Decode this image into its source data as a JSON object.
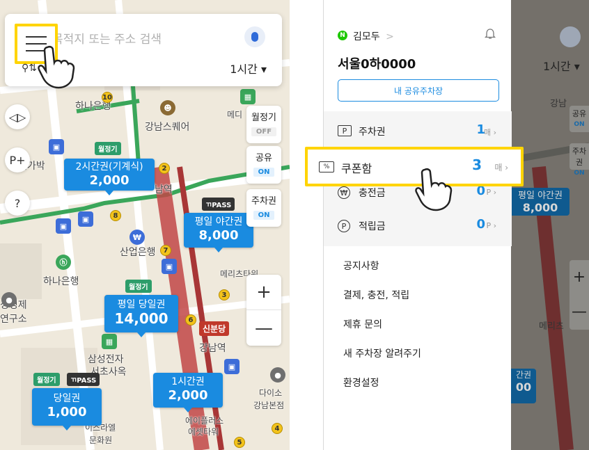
{
  "left": {
    "search": {
      "placeholder": "목적지 또는 주소 검색",
      "time": "1시간 ▾",
      "filter": "⚲⇅"
    },
    "map_labels": [
      {
        "text": "하나은행",
        "name": "map-label-hana-bank"
      },
      {
        "text": "강남스퀘어",
        "name": "map-label-gangnam-square"
      },
      {
        "text": "메가박",
        "name": "map-label-megabox"
      },
      {
        "text": "남역",
        "name": "map-label-namyeok"
      },
      {
        "text": "산업은행",
        "name": "map-label-sanup-bank"
      },
      {
        "text": "하나은행",
        "name": "map-label-hana-bank-2"
      },
      {
        "text": "메리츠타워",
        "name": "map-label-meritz-tower"
      },
      {
        "text": "성경제",
        "name": "map-label-economy"
      },
      {
        "text": "연구소",
        "name": "map-label-institute"
      },
      {
        "text": "강남역",
        "name": "map-label-gangnam-station"
      },
      {
        "text": "삼성전자",
        "name": "map-label-samsung"
      },
      {
        "text": "서초사옥",
        "name": "map-label-seocho-office"
      },
      {
        "text": "다이소",
        "name": "map-label-daiso"
      },
      {
        "text": "강남본점",
        "name": "map-label-gangnam-main"
      },
      {
        "text": "에이플러스",
        "name": "map-label-aplus"
      },
      {
        "text": "에셋타워",
        "name": "map-label-asset-tower"
      },
      {
        "text": "이스라엘",
        "name": "map-label-israel"
      },
      {
        "text": "문화원",
        "name": "map-label-culture"
      },
      {
        "text": "신분당",
        "name": "map-label-sinbundang"
      },
      {
        "text": "메디",
        "name": "map-label-medi"
      }
    ],
    "toggles": [
      {
        "label": "월정기",
        "state": "OFF",
        "on": false
      },
      {
        "label": "공유",
        "state": "ON",
        "on": true
      },
      {
        "label": "주차권",
        "state": "ON",
        "on": true
      }
    ],
    "zoom": {
      "plus": "+",
      "minus": "—"
    },
    "prices": [
      {
        "name": "2시간권(기계식)",
        "value": "2,000"
      },
      {
        "name": "평일 야간권",
        "value": "8,000"
      },
      {
        "name": "평일 당일권",
        "value": "14,000"
      },
      {
        "name": "1시간권",
        "value": "2,000"
      },
      {
        "name": "당일권",
        "value": "1,000"
      }
    ],
    "badges": {
      "monthly": "월정기",
      "pass": "ㄲPASS"
    },
    "side_buttons": [
      "◁▷",
      "P+",
      "?"
    ],
    "station_numbers": [
      "10",
      "8",
      "7",
      "3",
      "6",
      "5",
      "4",
      "2"
    ]
  },
  "drawer": {
    "user": "김모두",
    "user_chevron": ">",
    "naver": "N",
    "plate": "서울0하0000",
    "share_button": "내 공유주차장",
    "wallet": [
      {
        "icon": "P",
        "label": "주차권",
        "count": "1",
        "unit": "매 ›"
      },
      {
        "icon": "%",
        "label": "쿠폰함",
        "count": "3",
        "unit": "매 ›"
      },
      {
        "icon": "₩",
        "label": "충전금",
        "count": "0",
        "unit": "P ›"
      },
      {
        "icon": "P",
        "label": "적립금",
        "count": "0",
        "unit": "P ›"
      }
    ],
    "menu": [
      "공지사항",
      "결제, 충전, 적립",
      "제휴 문의",
      "새 주차장 알려주기",
      "환경설정"
    ]
  },
  "right_map": {
    "time": "1시간 ▾",
    "zoom_plus": "+",
    "zoom_minus": "—",
    "labels": [
      "강남",
      "공유",
      "ON",
      "주차권",
      "ON",
      "평일 야간권",
      "8,000",
      "메리츠",
      "간권",
      "00"
    ]
  },
  "colors": {
    "accent": "#1a8be0",
    "highlight": "#ffd400",
    "naver": "#1ec800",
    "subway": "#b53a3a",
    "green_line": "#3aa65a"
  }
}
